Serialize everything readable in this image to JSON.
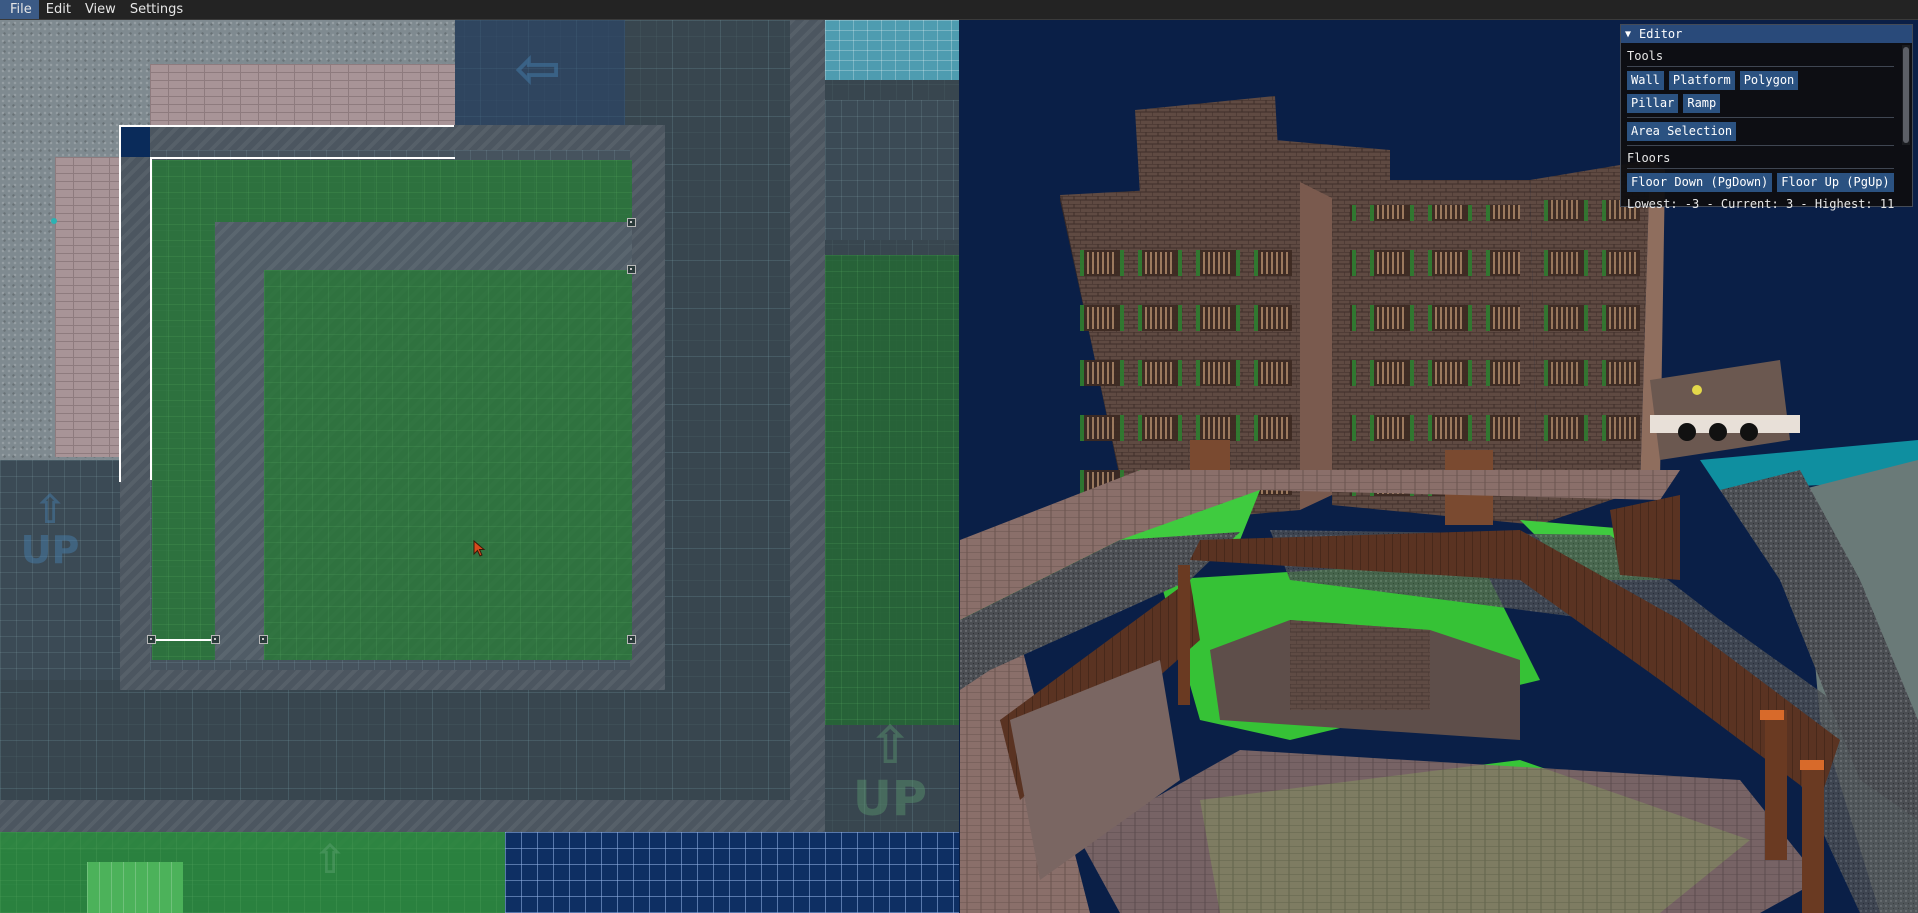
{
  "menu": {
    "file": "File",
    "edit": "Edit",
    "view": "View",
    "settings": "Settings"
  },
  "map": {
    "up_label": "UP",
    "icons": {
      "cursor": "arrow-cursor-icon",
      "stairs": "up-arrow-icon"
    },
    "colors": {
      "platform": "#2b7a3a",
      "selection": "#ffffff",
      "grid": "#0e2f63"
    }
  },
  "editor": {
    "title": "Editor",
    "tools_label": "Tools",
    "tools": {
      "wall": "Wall",
      "platform": "Platform",
      "polygon": "Polygon",
      "pillar": "Pillar",
      "ramp": "Ramp"
    },
    "area_selection": "Area Selection",
    "floors_label": "Floors",
    "floor_down": "Floor Down (PgDown)",
    "floor_up": "Floor Up (PgUp)",
    "floor_info": "Lowest: -3 - Current: 3 - Highest: 11",
    "colors": {
      "title_bar": "#294a7a",
      "button": "#2b5281"
    }
  }
}
